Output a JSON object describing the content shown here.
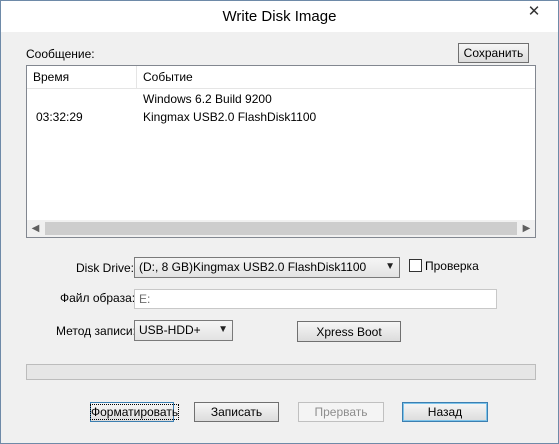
{
  "window": {
    "title": "Write Disk Image",
    "close_glyph": "✕"
  },
  "log": {
    "label": "Сообщение:",
    "save_label": "Сохранить",
    "columns": [
      "Время",
      "Событие"
    ],
    "rows": [
      {
        "time": "",
        "event": "Windows 6.2 Build 9200"
      },
      {
        "time": "03:32:29",
        "event": "Kingmax USB2.0 FlashDisk1100"
      }
    ]
  },
  "drive": {
    "label": "Disk Drive:",
    "selected": "(D:, 8 GB)Kingmax USB2.0 FlashDisk1100",
    "verify_label": "Проверка",
    "verify_checked": false
  },
  "image_file": {
    "label": "Файл образа:",
    "value": "E:"
  },
  "write_method": {
    "label": "Метод записи:",
    "selected": "USB-HDD+",
    "xpress_label": "Xpress Boot"
  },
  "progress": {
    "fraction": 0
  },
  "buttons": {
    "format": "Форматировать",
    "write": "Записать",
    "abort": "Прервать",
    "back": "Назад"
  }
}
